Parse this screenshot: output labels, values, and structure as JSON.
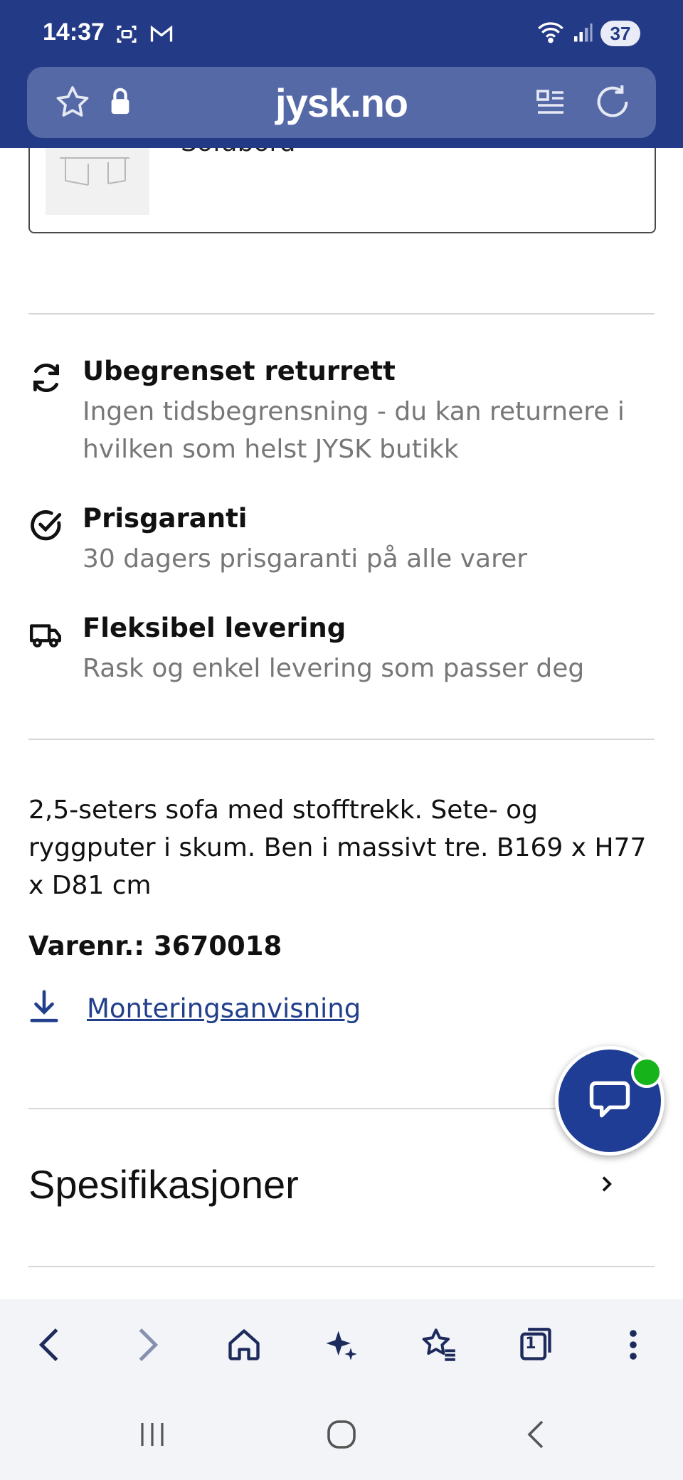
{
  "status_bar": {
    "time": "14:37",
    "battery": "37",
    "icons": [
      "screenshot-icon",
      "gmail-icon",
      "wifi-icon",
      "signal-icon"
    ]
  },
  "browser": {
    "url": "jysk.no",
    "icons": [
      "bookmark-star-icon",
      "lock-icon",
      "reader-mode-icon",
      "reload-icon"
    ]
  },
  "related_product": {
    "title": "Sofabord"
  },
  "features": [
    {
      "icon": "return-arrows-icon",
      "title": "Ubegrenset returrett",
      "description": "Ingen tidsbegrensning - du kan returnere i hvilken som helst JYSK butikk"
    },
    {
      "icon": "check-circle-icon",
      "title": "Prisgaranti",
      "description": "30 dagers prisgaranti på alle varer"
    },
    {
      "icon": "delivery-truck-icon",
      "title": "Fleksibel levering",
      "description": "Rask og enkel levering som passer deg"
    }
  ],
  "product": {
    "description": "2,5-seters sofa med stofftrekk. Sete- og ryggputer i skum. Ben i massivt tre. B169 x H77 x D81 cm",
    "sku_label": "Varenr.:",
    "sku_value": "3670018",
    "manual_link": "Monteringsanvisning"
  },
  "specifications": {
    "title": "Spesifikasjoner"
  },
  "colors": {
    "brand_blue": "#233a86",
    "url_bar": "#5569a7",
    "link": "#223f8c",
    "chat_online": "#16b31b"
  },
  "bottom_toolbar": [
    "back-icon",
    "forward-icon",
    "home-icon",
    "ai-sparkle-icon",
    "bookmarks-icon",
    "tabs-icon",
    "more-icon"
  ],
  "tab_count": "1",
  "system_nav": [
    "recent-apps-icon",
    "home-circle-icon",
    "system-back-icon"
  ]
}
